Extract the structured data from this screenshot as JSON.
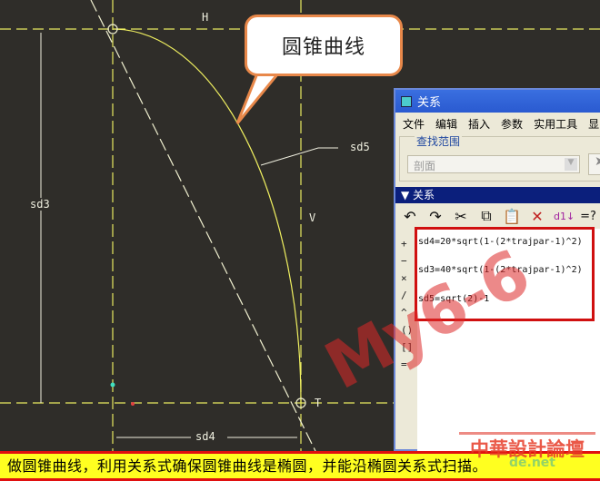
{
  "cad": {
    "labels": {
      "h": "H",
      "v": "V",
      "t": "T",
      "sd3": "sd3",
      "sd4": "sd4",
      "sd5": "sd5"
    },
    "curve_color": "#f0f060"
  },
  "callout": {
    "text": "圆锥曲线"
  },
  "dialog": {
    "title": "关系",
    "menu": [
      "文件",
      "编辑",
      "插入",
      "参数",
      "实用工具",
      "显"
    ],
    "find_scope": {
      "legend": "查找范围",
      "selected": "剖面"
    },
    "section": "关系",
    "toolbar_icons": [
      "undo-icon",
      "redo-icon",
      "cut-icon",
      "copy-icon",
      "paste-icon",
      "delete-icon",
      "sort-icon",
      "evaluate-icon"
    ],
    "operators": [
      "+",
      "−",
      "×",
      "/",
      "^",
      "()",
      "[]",
      "="
    ],
    "relations": [
      "sd4=20*sqrt(1-(2*trajpar-1)^2)",
      "sd3=40*sqrt(1-(2*trajpar-1)^2)",
      "sd5=sqrt(2)-1"
    ]
  },
  "watermark": "My6-6",
  "banner": "做圆锥曲线，利用关系式确保圆锥曲线是椭圆，并能沿椭圆关系式扫描。",
  "logo": {
    "text": "中華設計論壇",
    "url": "de.net"
  }
}
